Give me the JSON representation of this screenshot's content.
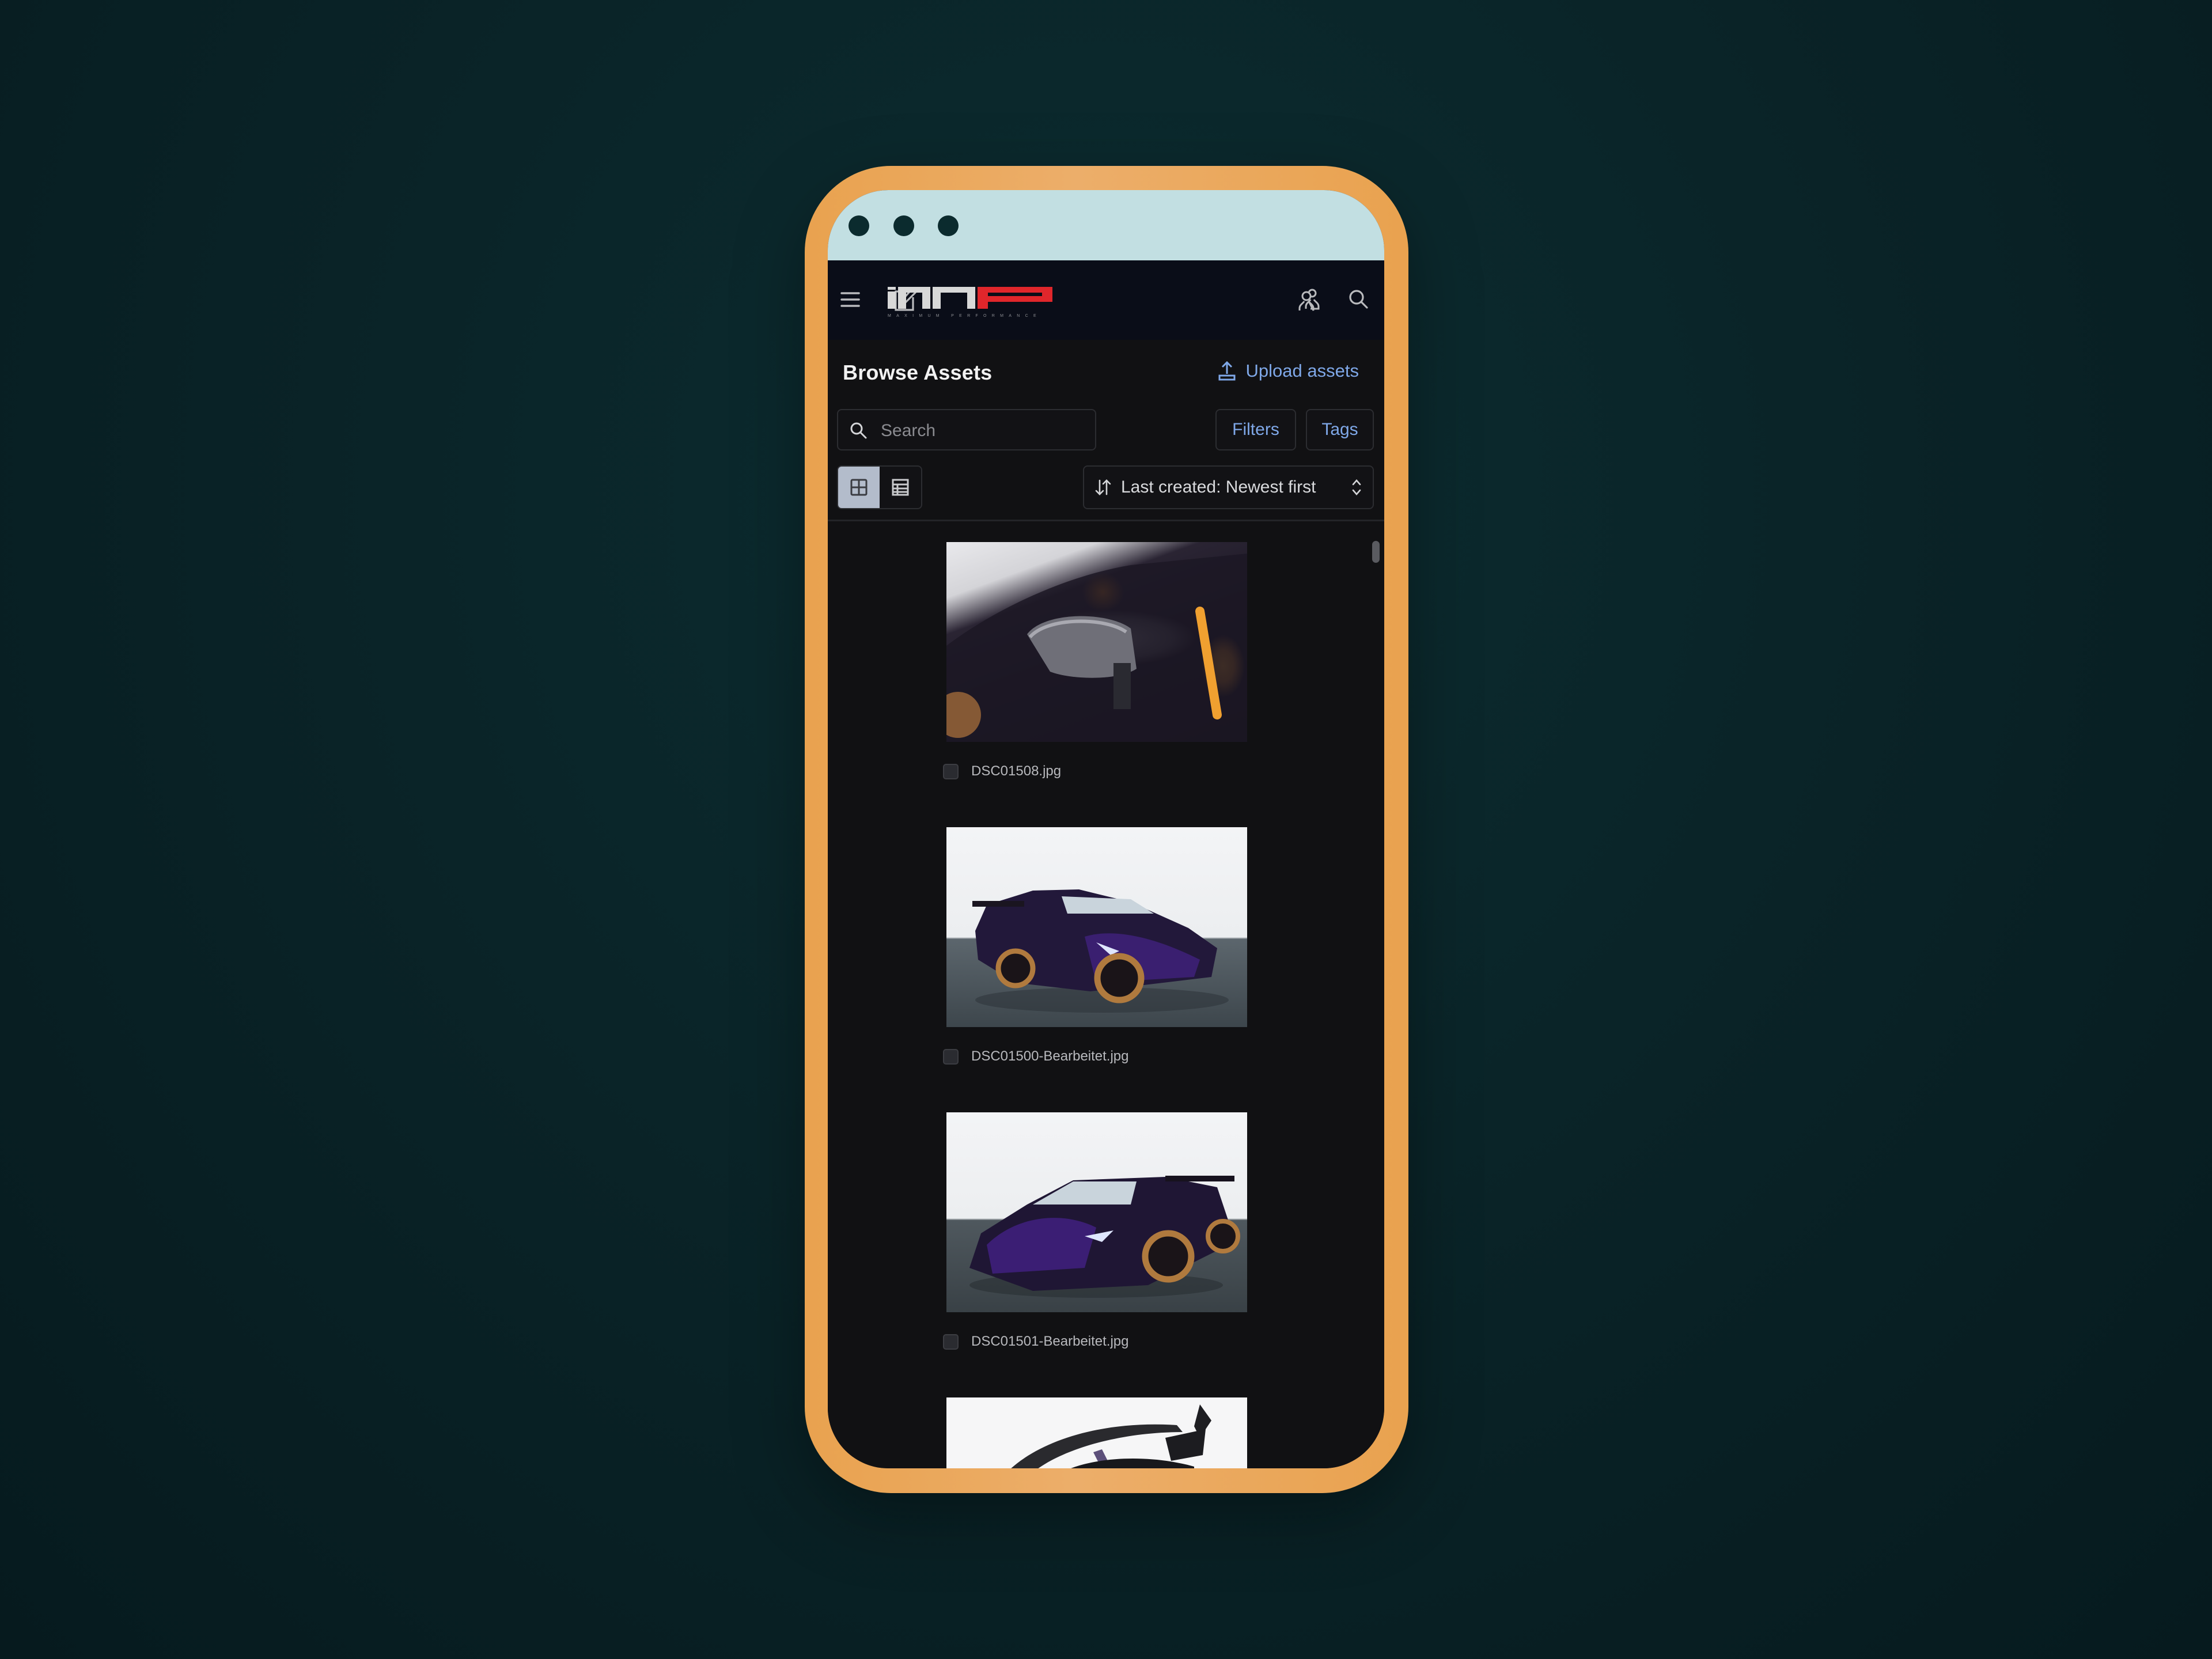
{
  "window": {
    "traffic_dots": 3
  },
  "appbar": {
    "menu_icon": "hamburger-menu-icon",
    "edit_icon": "edit-note-icon",
    "logo": {
      "letters": "MP",
      "tagline": "MAXIMUM PERFORMANCE",
      "primary_color": "#d8d8d8",
      "accent_color": "#e0262b"
    },
    "users_icon": "users-icon",
    "search_icon": "search-icon"
  },
  "page": {
    "title": "Browse Assets",
    "upload_label": "Upload assets",
    "upload_icon": "upload-icon"
  },
  "toolbar": {
    "search_placeholder": "Search",
    "search_value": "",
    "filters_label": "Filters",
    "tags_label": "Tags",
    "view_modes": [
      {
        "name": "grid",
        "icon": "grid-view-icon",
        "active": true
      },
      {
        "name": "table",
        "icon": "table-view-icon",
        "active": false
      }
    ],
    "sort_icon": "sort-arrows-icon",
    "sort_label": "Last created: Newest first",
    "sort_chevron": "chevron-up-down-icon"
  },
  "assets": [
    {
      "filename": "DSC01508.jpg",
      "checked": false,
      "preview": "Close-up of carbon-fiber side mirror on a purple Lamborghini, orange interior accents"
    },
    {
      "filename": "DSC01500-Bearbeitet.jpg",
      "checked": false,
      "preview": "Purple Lamborghini Aventador SVJ, front three-quarter view from the right, bronze wheels"
    },
    {
      "filename": "DSC01501-Bearbeitet.jpg",
      "checked": false,
      "preview": "Purple Lamborghini Aventador SVJ, front three-quarter view from the left, bronze wheels"
    },
    {
      "filename": "",
      "checked": false,
      "preview": "Rear wing of the purple Lamborghini (partially visible)"
    }
  ],
  "colors": {
    "accent_link": "#7fa8e8",
    "frame": "#eaa24e",
    "titlebar": "#c2dfe2",
    "appbar": "#0a0d18",
    "content_bg": "#111113"
  }
}
